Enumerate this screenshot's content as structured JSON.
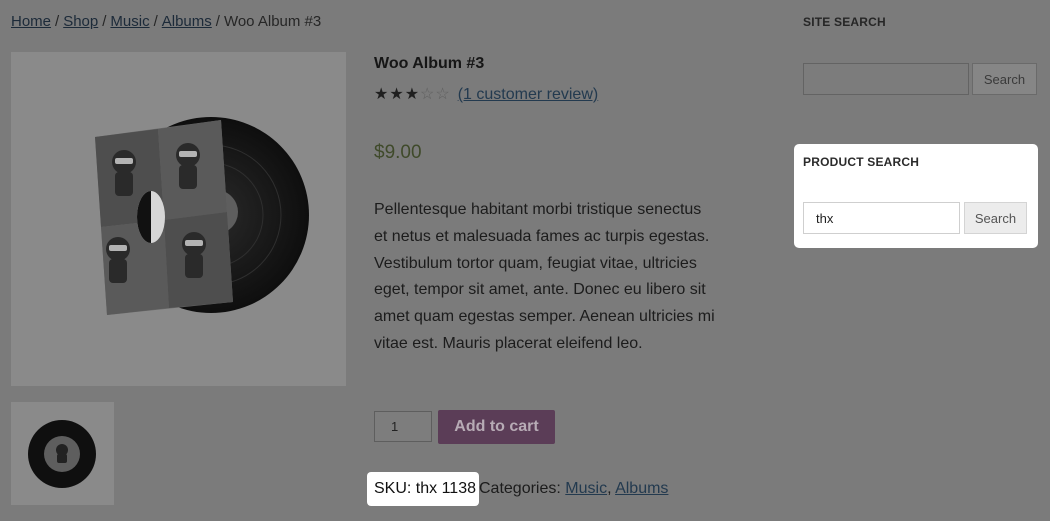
{
  "breadcrumb": {
    "items": [
      "Home",
      "Shop",
      "Music",
      "Albums"
    ],
    "current": "Woo Album #3",
    "separator": "/"
  },
  "product": {
    "title": "Woo Album #3",
    "rating_value": 3,
    "rating_max": 5,
    "review_link": "(1 customer review)",
    "price": "$9.00",
    "description": "Pellentesque habitant morbi tristique senectus et netus et malesuada fames ac turpis egestas. Vestibulum tortor quam, feugiat vitae, ultricies eget, tempor sit amet, ante. Donec eu libero sit amet quam egestas semper. Aenean ultricies mi vitae est. Mauris placerat eleifend leo.",
    "quantity": "1",
    "add_to_cart_label": "Add to cart",
    "sku": "SKU: thx 1138",
    "categories_label": "Categories:",
    "categories": [
      "Music",
      "Albums"
    ],
    "category_separator": ","
  },
  "sidebar": {
    "site_search": {
      "title": "SITE SEARCH",
      "value": "",
      "button_label": "Search"
    },
    "product_search": {
      "title": "PRODUCT SEARCH",
      "value": "thx",
      "button_label": "Search"
    }
  },
  "colors": {
    "overlay": "#7b7b7b",
    "add_to_cart": "#5b3d57",
    "price": "#3f4a2a",
    "highlight": "#ffffff"
  }
}
